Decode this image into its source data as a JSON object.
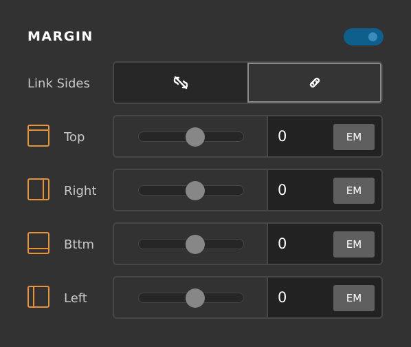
{
  "section": {
    "title": "MARGIN",
    "toggle_on": true,
    "accent": "#0e5f8c"
  },
  "link_sides": {
    "label": "Link Sides",
    "options": [
      "unlink-icon",
      "link-icon"
    ],
    "selected": "link"
  },
  "icon_color": "#e8923a",
  "rows": [
    {
      "name": "Top",
      "value": "0",
      "unit": "EM",
      "slider_level": 0.5
    },
    {
      "name": "Right",
      "value": "0",
      "unit": "EM",
      "slider_level": 0.5
    },
    {
      "name": "Bttm",
      "value": "0",
      "unit": "EM",
      "slider_level": 0.5
    },
    {
      "name": "Left",
      "value": "0",
      "unit": "EM",
      "slider_level": 0.5
    }
  ]
}
